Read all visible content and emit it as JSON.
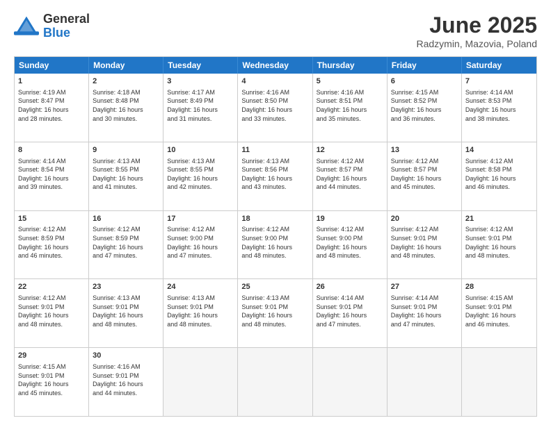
{
  "header": {
    "logo_general": "General",
    "logo_blue": "Blue",
    "title": "June 2025",
    "location": "Radzymin, Mazovia, Poland"
  },
  "days_of_week": [
    "Sunday",
    "Monday",
    "Tuesday",
    "Wednesday",
    "Thursday",
    "Friday",
    "Saturday"
  ],
  "weeks": [
    [
      {
        "num": "1",
        "info": "Sunrise: 4:19 AM\nSunset: 8:47 PM\nDaylight: 16 hours\nand 28 minutes."
      },
      {
        "num": "2",
        "info": "Sunrise: 4:18 AM\nSunset: 8:48 PM\nDaylight: 16 hours\nand 30 minutes."
      },
      {
        "num": "3",
        "info": "Sunrise: 4:17 AM\nSunset: 8:49 PM\nDaylight: 16 hours\nand 31 minutes."
      },
      {
        "num": "4",
        "info": "Sunrise: 4:16 AM\nSunset: 8:50 PM\nDaylight: 16 hours\nand 33 minutes."
      },
      {
        "num": "5",
        "info": "Sunrise: 4:16 AM\nSunset: 8:51 PM\nDaylight: 16 hours\nand 35 minutes."
      },
      {
        "num": "6",
        "info": "Sunrise: 4:15 AM\nSunset: 8:52 PM\nDaylight: 16 hours\nand 36 minutes."
      },
      {
        "num": "7",
        "info": "Sunrise: 4:14 AM\nSunset: 8:53 PM\nDaylight: 16 hours\nand 38 minutes."
      }
    ],
    [
      {
        "num": "8",
        "info": "Sunrise: 4:14 AM\nSunset: 8:54 PM\nDaylight: 16 hours\nand 39 minutes."
      },
      {
        "num": "9",
        "info": "Sunrise: 4:13 AM\nSunset: 8:55 PM\nDaylight: 16 hours\nand 41 minutes."
      },
      {
        "num": "10",
        "info": "Sunrise: 4:13 AM\nSunset: 8:55 PM\nDaylight: 16 hours\nand 42 minutes."
      },
      {
        "num": "11",
        "info": "Sunrise: 4:13 AM\nSunset: 8:56 PM\nDaylight: 16 hours\nand 43 minutes."
      },
      {
        "num": "12",
        "info": "Sunrise: 4:12 AM\nSunset: 8:57 PM\nDaylight: 16 hours\nand 44 minutes."
      },
      {
        "num": "13",
        "info": "Sunrise: 4:12 AM\nSunset: 8:57 PM\nDaylight: 16 hours\nand 45 minutes."
      },
      {
        "num": "14",
        "info": "Sunrise: 4:12 AM\nSunset: 8:58 PM\nDaylight: 16 hours\nand 46 minutes."
      }
    ],
    [
      {
        "num": "15",
        "info": "Sunrise: 4:12 AM\nSunset: 8:59 PM\nDaylight: 16 hours\nand 46 minutes."
      },
      {
        "num": "16",
        "info": "Sunrise: 4:12 AM\nSunset: 8:59 PM\nDaylight: 16 hours\nand 47 minutes."
      },
      {
        "num": "17",
        "info": "Sunrise: 4:12 AM\nSunset: 9:00 PM\nDaylight: 16 hours\nand 47 minutes."
      },
      {
        "num": "18",
        "info": "Sunrise: 4:12 AM\nSunset: 9:00 PM\nDaylight: 16 hours\nand 48 minutes."
      },
      {
        "num": "19",
        "info": "Sunrise: 4:12 AM\nSunset: 9:00 PM\nDaylight: 16 hours\nand 48 minutes."
      },
      {
        "num": "20",
        "info": "Sunrise: 4:12 AM\nSunset: 9:01 PM\nDaylight: 16 hours\nand 48 minutes."
      },
      {
        "num": "21",
        "info": "Sunrise: 4:12 AM\nSunset: 9:01 PM\nDaylight: 16 hours\nand 48 minutes."
      }
    ],
    [
      {
        "num": "22",
        "info": "Sunrise: 4:12 AM\nSunset: 9:01 PM\nDaylight: 16 hours\nand 48 minutes."
      },
      {
        "num": "23",
        "info": "Sunrise: 4:13 AM\nSunset: 9:01 PM\nDaylight: 16 hours\nand 48 minutes."
      },
      {
        "num": "24",
        "info": "Sunrise: 4:13 AM\nSunset: 9:01 PM\nDaylight: 16 hours\nand 48 minutes."
      },
      {
        "num": "25",
        "info": "Sunrise: 4:13 AM\nSunset: 9:01 PM\nDaylight: 16 hours\nand 48 minutes."
      },
      {
        "num": "26",
        "info": "Sunrise: 4:14 AM\nSunset: 9:01 PM\nDaylight: 16 hours\nand 47 minutes."
      },
      {
        "num": "27",
        "info": "Sunrise: 4:14 AM\nSunset: 9:01 PM\nDaylight: 16 hours\nand 47 minutes."
      },
      {
        "num": "28",
        "info": "Sunrise: 4:15 AM\nSunset: 9:01 PM\nDaylight: 16 hours\nand 46 minutes."
      }
    ],
    [
      {
        "num": "29",
        "info": "Sunrise: 4:15 AM\nSunset: 9:01 PM\nDaylight: 16 hours\nand 45 minutes."
      },
      {
        "num": "30",
        "info": "Sunrise: 4:16 AM\nSunset: 9:01 PM\nDaylight: 16 hours\nand 44 minutes."
      },
      {
        "num": "",
        "info": "",
        "empty": true
      },
      {
        "num": "",
        "info": "",
        "empty": true
      },
      {
        "num": "",
        "info": "",
        "empty": true
      },
      {
        "num": "",
        "info": "",
        "empty": true
      },
      {
        "num": "",
        "info": "",
        "empty": true
      }
    ]
  ]
}
